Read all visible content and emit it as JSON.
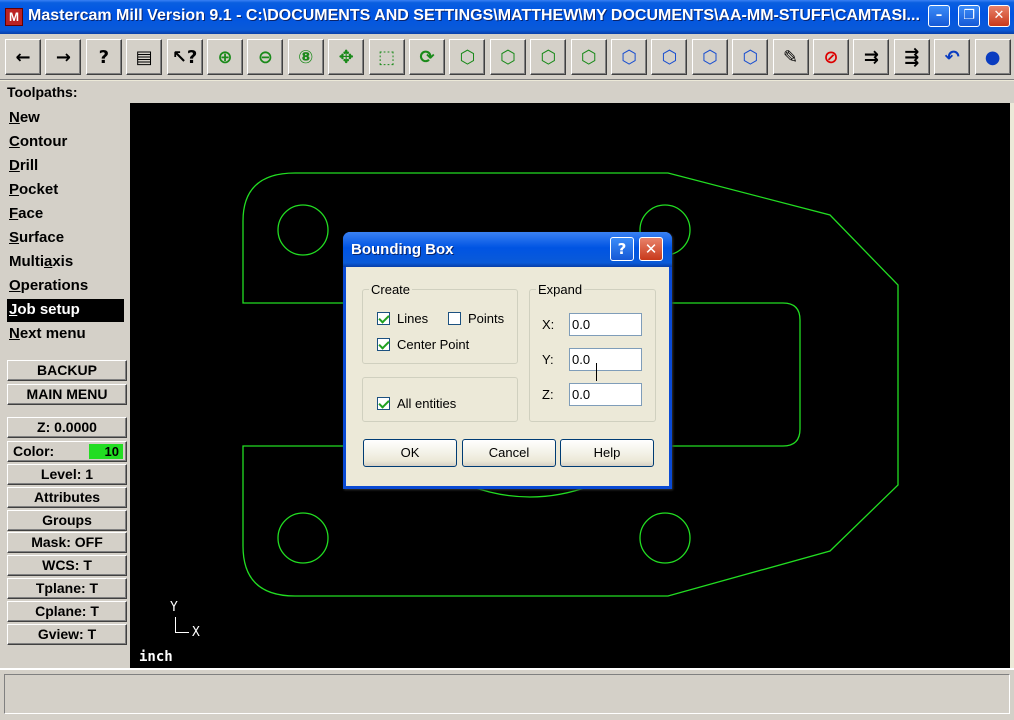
{
  "window": {
    "title": "Mastercam Mill Version 9.1 - C:\\DOCUMENTS AND SETTINGS\\MATTHEW\\MY DOCUMENTS\\AA-MM-STUFF\\CAMTASI...",
    "minimize": "–",
    "maximize": "❐",
    "close": "✕"
  },
  "toolbar": {
    "buttons": [
      {
        "name": "back-icon",
        "glyph": "←"
      },
      {
        "name": "forward-icon",
        "glyph": "→"
      },
      {
        "name": "help-icon",
        "glyph": "?"
      },
      {
        "name": "calculator-icon",
        "glyph": "▤"
      },
      {
        "name": "analyze-icon",
        "glyph": "↖?"
      },
      {
        "name": "zoom-window-icon",
        "glyph": "⊕"
      },
      {
        "name": "zoom-out-icon",
        "glyph": "⊖"
      },
      {
        "name": "zoom-scale-icon",
        "glyph": "⑧"
      },
      {
        "name": "pan-icon",
        "glyph": "✥"
      },
      {
        "name": "auto-cursor-icon",
        "glyph": "⬚"
      },
      {
        "name": "dynamic-rotate-icon",
        "glyph": "⟳"
      },
      {
        "name": "gview-top-icon",
        "glyph": "⬡"
      },
      {
        "name": "gview-front-icon",
        "glyph": "⬡"
      },
      {
        "name": "gview-side-icon",
        "glyph": "⬡"
      },
      {
        "name": "gview-iso-icon",
        "glyph": "⬡"
      },
      {
        "name": "cplane-top-icon",
        "glyph": "⬡"
      },
      {
        "name": "cplane-front-icon",
        "glyph": "⬡"
      },
      {
        "name": "cplane-side-icon",
        "glyph": "⬡"
      },
      {
        "name": "cplane-3d-icon",
        "glyph": "⬡"
      },
      {
        "name": "edit-pencil-icon",
        "glyph": "✎"
      },
      {
        "name": "delete-icon",
        "glyph": "⊘"
      },
      {
        "name": "screen-transform-icon",
        "glyph": "⇉"
      },
      {
        "name": "screen-color-icon",
        "glyph": "⇶"
      },
      {
        "name": "undo-icon",
        "glyph": "↶"
      },
      {
        "name": "shade-sphere-icon",
        "glyph": "●"
      }
    ]
  },
  "toolpaths_label": "Toolpaths:",
  "menu": [
    {
      "key": "N",
      "rest": "ew",
      "id": "new"
    },
    {
      "key": "C",
      "rest": "ontour",
      "id": "contour"
    },
    {
      "key": "D",
      "rest": "rill",
      "id": "drill"
    },
    {
      "key": "P",
      "rest": "ocket",
      "id": "pocket"
    },
    {
      "key": "F",
      "rest": "ace",
      "id": "face"
    },
    {
      "key": "S",
      "rest": "urface",
      "id": "surface"
    },
    {
      "pre": "Multi",
      "key": "a",
      "rest": "xis",
      "id": "multiaxis"
    },
    {
      "key": "O",
      "rest": "perations",
      "id": "operations"
    },
    {
      "key": "J",
      "rest": "ob setup",
      "id": "job-setup",
      "selected": true
    },
    {
      "key": "N",
      "rest": "ext menu",
      "id": "next-menu"
    }
  ],
  "side_buttons": {
    "backup": "BACKUP",
    "main_menu": "MAIN MENU",
    "z": "Z:  0.0000",
    "color_label": "Color:",
    "color_value": "10",
    "level": "Level:  1",
    "attributes": "Attributes",
    "groups": "Groups",
    "mask": "Mask:  OFF",
    "wcs": "WCS:  T",
    "tplane": "Tplane:  T",
    "cplane": "Cplane:  T",
    "gview": "Gview:  T"
  },
  "viewport": {
    "axis_y": "Y",
    "axis_x": "X",
    "units": "inch",
    "geometry_color": "#22dd22"
  },
  "dialog": {
    "title": "Bounding Box",
    "help_glyph": "?",
    "close_glyph": "✕",
    "create_legend": "Create",
    "lines_label": "Lines",
    "lines_checked": true,
    "points_label": "Points",
    "points_checked": false,
    "center_point_label": "Center Point",
    "center_point_checked": true,
    "all_entities_label": "All entities",
    "all_entities_checked": true,
    "expand_legend": "Expand",
    "x_label": "X:",
    "x_value": "0.0",
    "y_label": "Y:",
    "y_value": "0.0",
    "z_label": "Z:",
    "z_value": "0.0",
    "ok": "OK",
    "cancel": "Cancel",
    "help": "Help"
  }
}
